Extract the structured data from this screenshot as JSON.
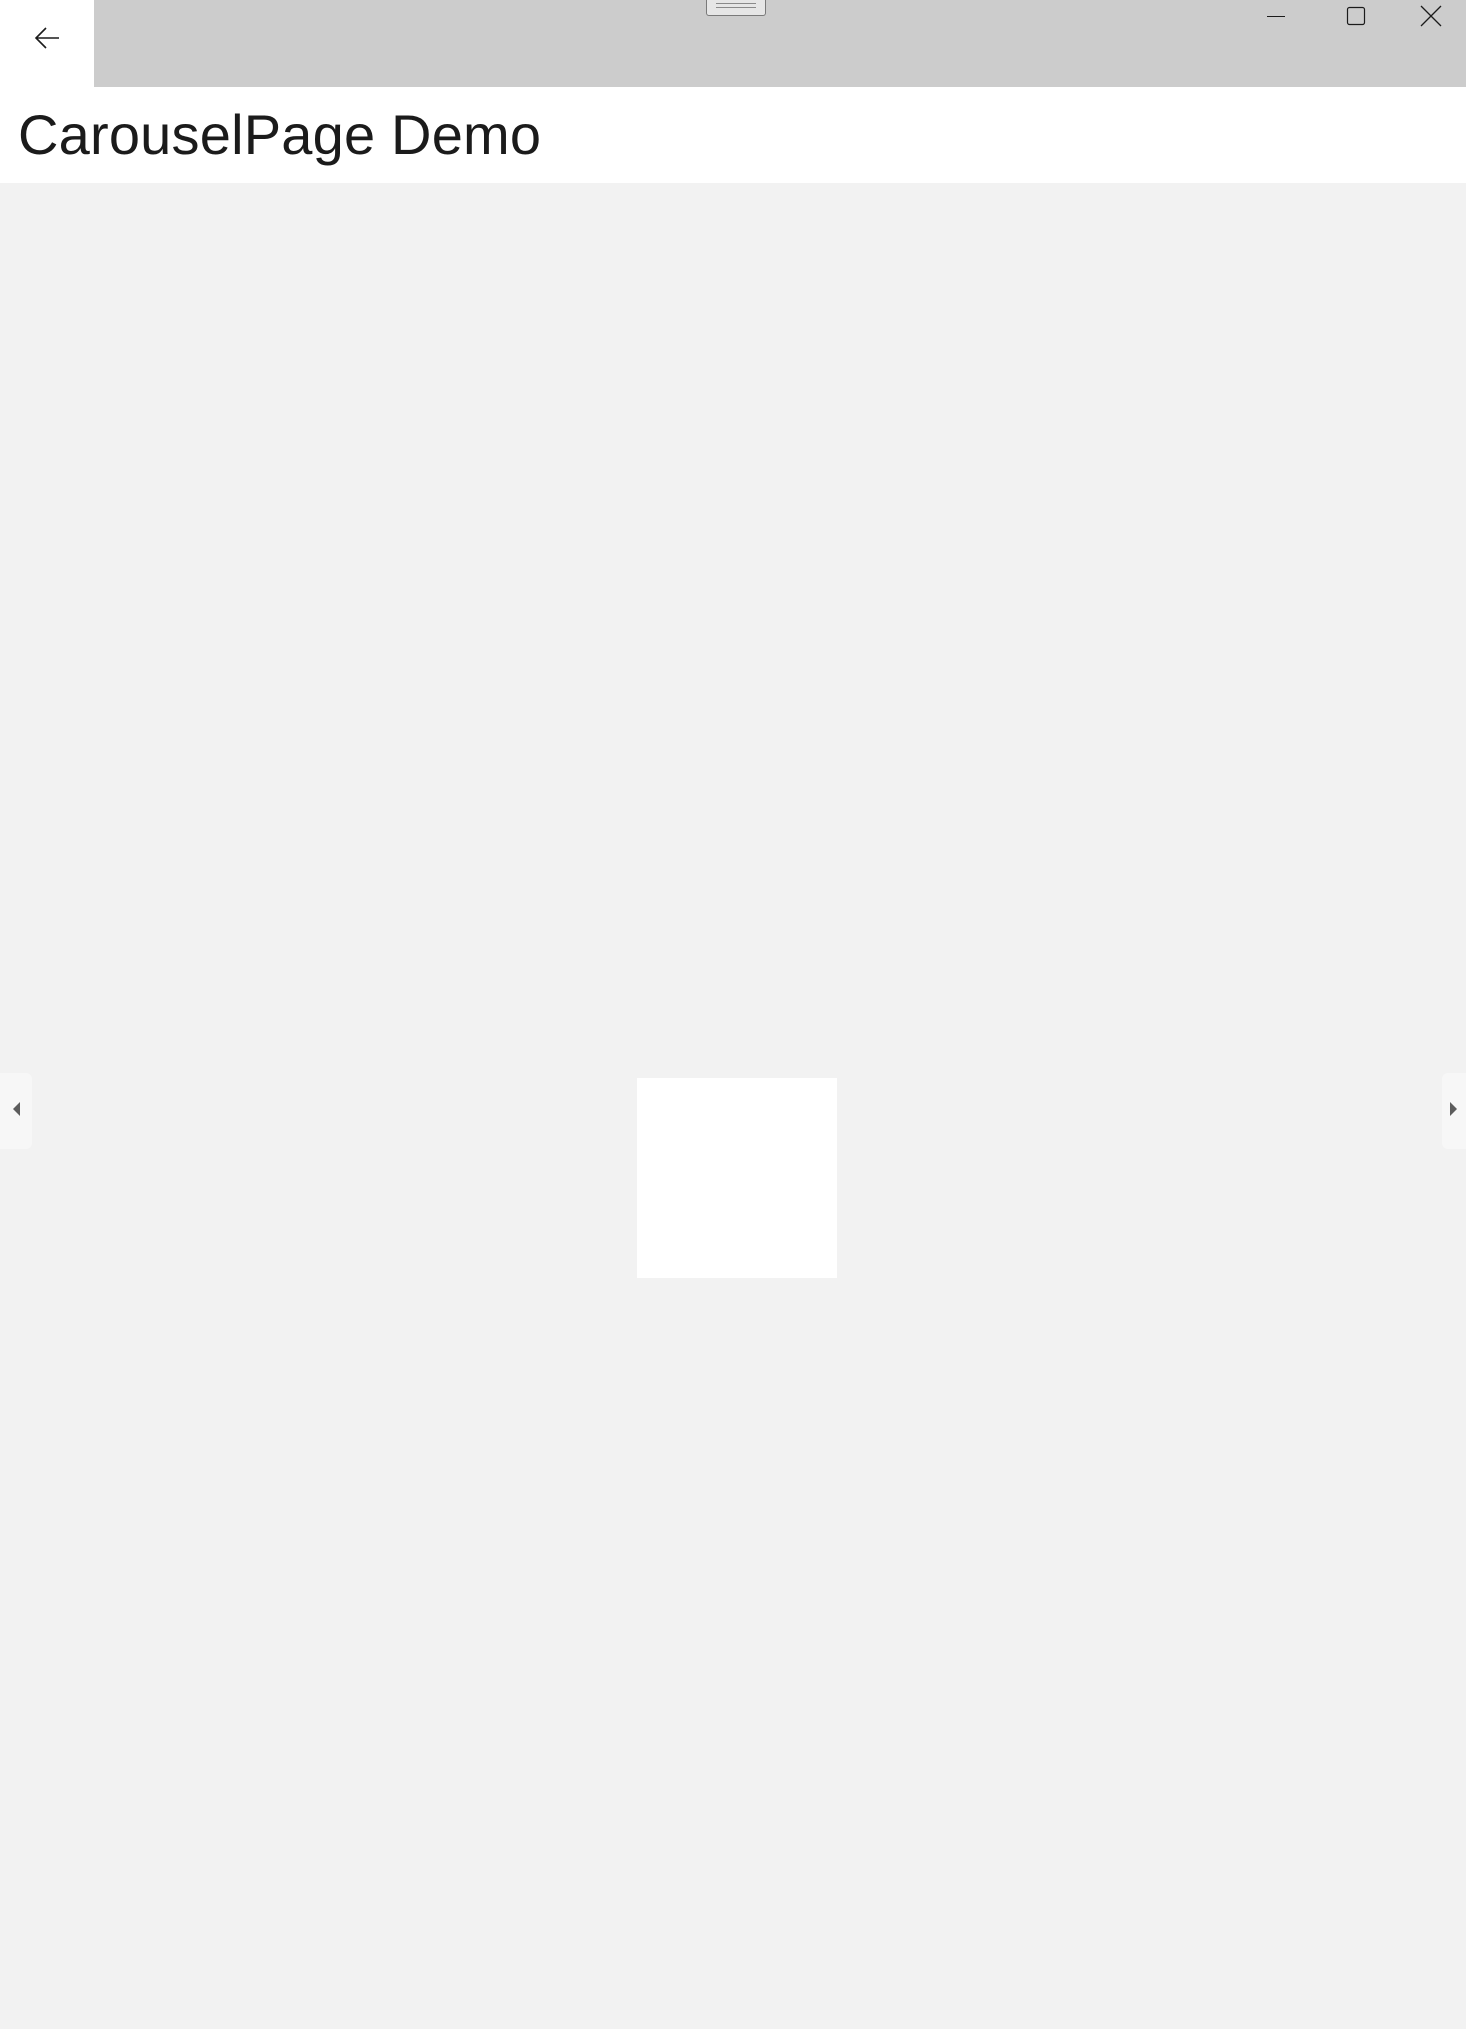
{
  "window": {
    "title_bar": {
      "back_icon": "arrow-left-icon",
      "drag_handle_icon": "drag-handle-icon",
      "minimize_icon": "minimize-icon",
      "maximize_icon": "maximize-icon",
      "close_icon": "close-icon",
      "background_color": "#cccccc"
    }
  },
  "header": {
    "title": "CarouselPage Demo",
    "background_color": "#ffffff"
  },
  "carousel": {
    "previous_icon": "caret-left-icon",
    "next_icon": "caret-right-icon",
    "background_color": "#f2f2f2",
    "item_color": "#ffffff"
  }
}
